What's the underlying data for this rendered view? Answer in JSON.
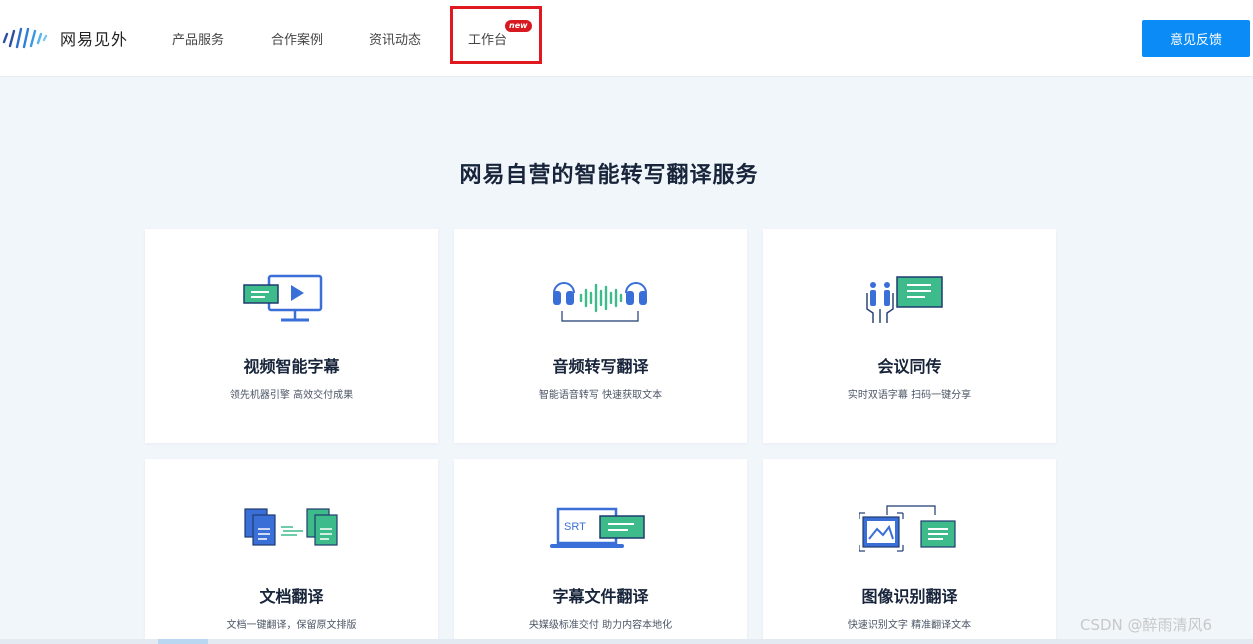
{
  "header": {
    "logo_text": "网易见外",
    "nav": [
      {
        "label": "产品服务"
      },
      {
        "label": "合作案例"
      },
      {
        "label": "资讯动态"
      },
      {
        "label": "工作台",
        "badge": "new"
      }
    ],
    "feedback_label": "意见反馈"
  },
  "main": {
    "title": "网易自营的智能转写翻译服务",
    "cards": [
      {
        "title": "视频智能字幕",
        "desc": "领先机器引擎 高效交付成果",
        "icon": "video-subtitle-icon"
      },
      {
        "title": "音频转写翻译",
        "desc": "智能语音转写 快速获取文本",
        "icon": "audio-transcribe-icon"
      },
      {
        "title": "会议同传",
        "desc": "实时双语字幕 扫码一键分享",
        "icon": "meeting-interpret-icon"
      },
      {
        "title": "文档翻译",
        "desc": "文档一键翻译，保留原文排版",
        "icon": "document-translate-icon"
      },
      {
        "title": "字幕文件翻译",
        "desc": "央媒级标准交付 助力内容本地化",
        "icon": "subtitle-file-icon",
        "icon_text": "SRT"
      },
      {
        "title": "图像识别翻译",
        "desc": "快速识别文字 精准翻译文本",
        "icon": "image-ocr-icon"
      }
    ]
  },
  "watermark": "CSDN @醉雨清风6",
  "colors": {
    "accent": "#0b8bf5",
    "badge": "#d71a21",
    "highlight_box": "#e0191f",
    "icon_blue": "#3a6fd8",
    "icon_green": "#3dbb8a",
    "page_bg": "#f1f6fb"
  }
}
